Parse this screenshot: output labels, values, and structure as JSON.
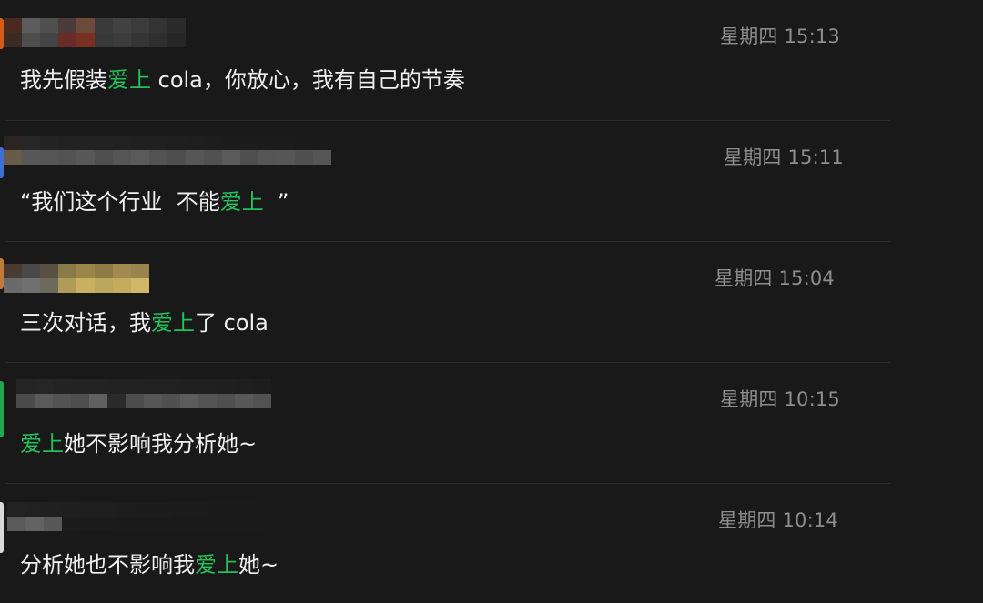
{
  "colors": {
    "background": "#191919",
    "text": "#f0f0f0",
    "timestamp": "#8e8e8e",
    "highlight": "#23c05b",
    "divider": "#2c2c2c"
  },
  "messages": [
    {
      "timestamp": "星期四 15:13",
      "text_parts": [
        "我先假装",
        "爱上",
        " cola，你放心，我有自己的节奏"
      ],
      "sender_name_blurred": true,
      "avatar_color": "#d65a18"
    },
    {
      "timestamp": "星期四 15:11",
      "text_parts": [
        "“我们这个行业  不能",
        "爱上",
        "  ”"
      ],
      "sender_name_blurred": true,
      "avatar_color": "#3d6fd6"
    },
    {
      "timestamp": "星期四 15:04",
      "text_parts": [
        "三次对话，我",
        "爱上",
        "了 cola"
      ],
      "sender_name_blurred": true,
      "avatar_color": "#c07a3a"
    },
    {
      "timestamp": "星期四 10:15",
      "text_parts": [
        "",
        "爱上",
        "她不影响我分析她~"
      ],
      "sender_name_blurred": true,
      "avatar_color": "#1fa84d"
    },
    {
      "timestamp": "星期四 10:14",
      "text_parts": [
        "分析她也不影响我",
        "爱上",
        "她~"
      ],
      "sender_name_blurred": true,
      "avatar_color": "#d9d9d9"
    }
  ]
}
